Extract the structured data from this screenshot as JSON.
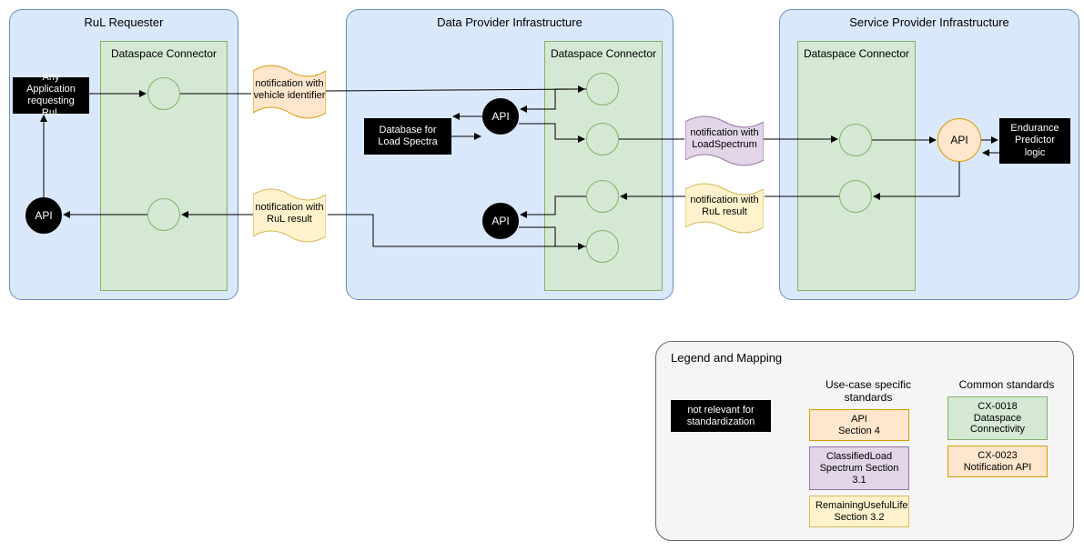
{
  "zones": {
    "rul": "RuL Requester",
    "dp": "Data Provider Infrastructure",
    "sp": "Service Provider Infrastructure"
  },
  "connector_label": "Dataspace Connector",
  "blocks": {
    "any_app": "Any Application requesting RuL",
    "db_spectra": "Database for Load Spectra",
    "endurance": "Endurance Predictor logic"
  },
  "api_label": "API",
  "notifications": {
    "vehicle_id": "notification with vehicle identifier",
    "loadspectrum": "notification with LoadSpectrum",
    "rul_result": "notification with RuL result"
  },
  "legend": {
    "title": "Legend and Mapping",
    "not_relevant": "not relevant for standardization",
    "usecase": "Use-case specific standards",
    "common": "Common standards",
    "api_sec": "API\nSection 4",
    "cls": "ClassifiedLoad Spectrum Section 3.1",
    "rul": "RemainingUsefulLife Section 3.2",
    "cx18": "CX-0018 Dataspace Connectivity",
    "cx23": "CX-0023 Notification API"
  }
}
